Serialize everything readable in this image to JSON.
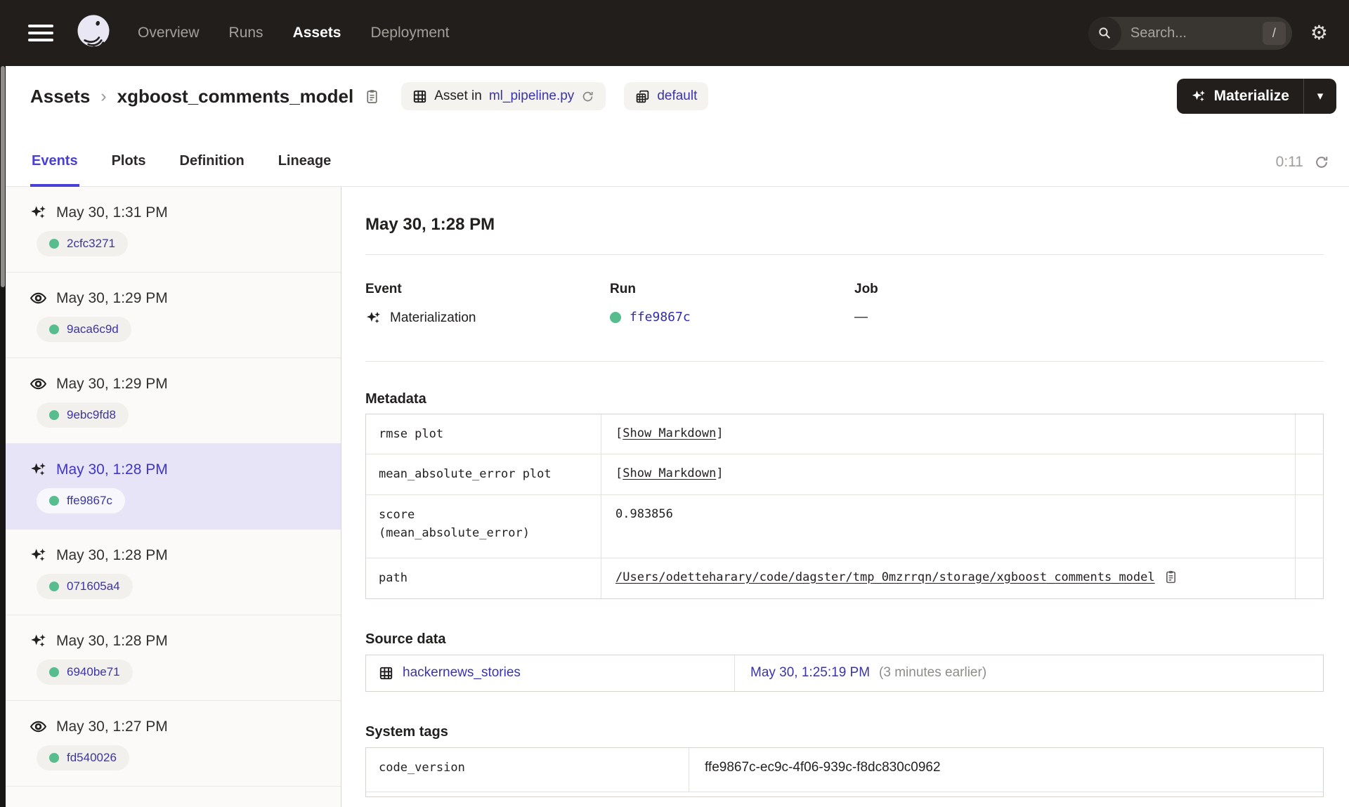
{
  "header": {
    "nav_items": [
      "Overview",
      "Runs",
      "Assets",
      "Deployment"
    ],
    "active_nav": "Assets",
    "search": {
      "placeholder": "Search...",
      "shortcut": "/"
    }
  },
  "breadcrumb": {
    "root": "Assets",
    "separator": "›",
    "current": "xgboost_comments_model"
  },
  "asset_badges": {
    "asset_in_label": "Asset in",
    "asset_file": "ml_pipeline.py",
    "code_location": "default"
  },
  "actions": {
    "materialize_label": "Materialize",
    "caret": "▾"
  },
  "tabs": {
    "items": [
      "Events",
      "Plots",
      "Definition",
      "Lineage"
    ],
    "active": "Events",
    "auto_refresh_timer": "0:11"
  },
  "sidebar": {
    "events": [
      {
        "type": "materialization",
        "time": "May 30, 1:31 PM",
        "run_id": "2cfc3271",
        "selected": false
      },
      {
        "type": "observation",
        "time": "May 30, 1:29 PM",
        "run_id": "9aca6c9d",
        "selected": false
      },
      {
        "type": "observation",
        "time": "May 30, 1:29 PM",
        "run_id": "9ebc9fd8",
        "selected": false
      },
      {
        "type": "materialization",
        "time": "May 30, 1:28 PM",
        "run_id": "ffe9867c",
        "selected": true
      },
      {
        "type": "materialization",
        "time": "May 30, 1:28 PM",
        "run_id": "071605a4",
        "selected": false
      },
      {
        "type": "materialization",
        "time": "May 30, 1:28 PM",
        "run_id": "6940be71",
        "selected": false
      },
      {
        "type": "observation",
        "time": "May 30, 1:27 PM",
        "run_id": "fd540026",
        "selected": false
      }
    ]
  },
  "detail": {
    "title": "May 30, 1:28 PM",
    "summary": {
      "event_label": "Event",
      "event_value": "Materialization",
      "run_label": "Run",
      "run_value": "ffe9867c",
      "job_label": "Job",
      "job_value": "—"
    },
    "metadata": {
      "heading": "Metadata",
      "rows": [
        {
          "key": "rmse plot",
          "bracket_l": "[",
          "link": "Show Markdown",
          "bracket_r": "]"
        },
        {
          "key": "mean_absolute_error plot",
          "bracket_l": "[",
          "link": "Show Markdown",
          "bracket_r": "]"
        },
        {
          "key_line1": "score",
          "key_line2": "(mean_absolute_error)",
          "value": "0.983856"
        },
        {
          "key": "path",
          "value": "/Users/odetteharary/code/dagster/tmp_0mzrrqn/storage/xgboost_comments_model"
        }
      ]
    },
    "source_data": {
      "heading": "Source data",
      "asset_name": "hackernews_stories",
      "materialized_at": "May 30, 1:25:19 PM",
      "relative_note": "(3 minutes earlier)"
    },
    "system_tags": {
      "heading": "System tags",
      "rows": [
        {
          "key": "code_version",
          "value": "ffe9867c-ec9c-4f06-939c-f8dc830c0962"
        }
      ]
    }
  },
  "colors": {
    "header_bg": "#211e1c",
    "accent_indigo": "#4a3fd6",
    "link_indigo": "#3a33ae",
    "run_status_green": "#58bd8e",
    "selected_row_bg": "#e7e4f7"
  }
}
